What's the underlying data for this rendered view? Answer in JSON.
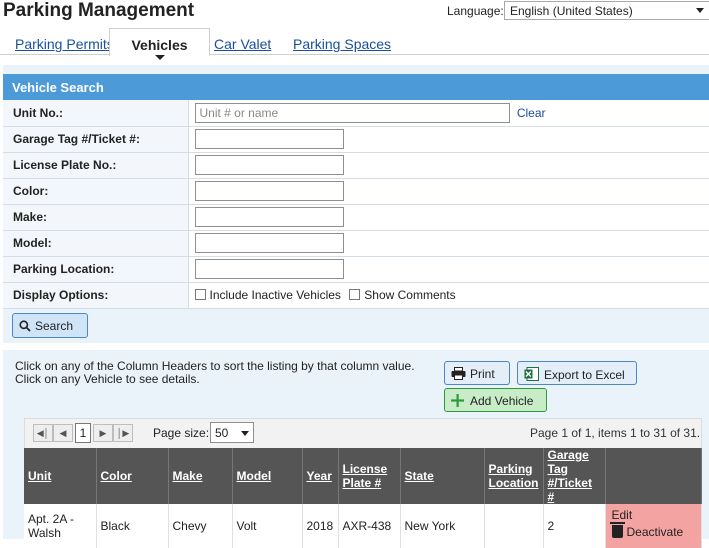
{
  "app": {
    "title": "Parking Management"
  },
  "language": {
    "label": "Language:",
    "selected": "English (United States)"
  },
  "tabs": [
    {
      "label": "Parking Permits",
      "active": false
    },
    {
      "label": "Vehicles",
      "active": true
    },
    {
      "label": "Car Valet",
      "active": false
    },
    {
      "label": "Parking Spaces",
      "active": false
    }
  ],
  "search_panel": {
    "title": "Vehicle Search",
    "fields": {
      "unit": {
        "label": "Unit No.:",
        "placeholder": "Unit # or name",
        "clear": "Clear"
      },
      "garage_tag": {
        "label": "Garage Tag #/Ticket #:"
      },
      "license_plate": {
        "label": "License Plate No.:"
      },
      "color": {
        "label": "Color:"
      },
      "make": {
        "label": "Make:"
      },
      "model": {
        "label": "Model:"
      },
      "parking_location": {
        "label": "Parking Location:"
      }
    },
    "display_options": {
      "label": "Display Options:",
      "include_inactive": "Include Inactive Vehicles",
      "show_comments": "Show Comments"
    },
    "search_button": "Search"
  },
  "results": {
    "hint": "Click on any of the Column Headers to sort the listing by that column value. Click on any Vehicle to see details.",
    "print_button": "Print",
    "export_button": "Export to Excel",
    "add_button": "Add Vehicle",
    "pager": {
      "current_page": "1",
      "page_size_label": "Page size:",
      "page_size": "50",
      "info": "Page 1 of 1, items 1 to 31 of 31."
    },
    "columns": [
      "Unit",
      "Color",
      "Make",
      "Model",
      "Year",
      "License Plate #",
      "State",
      "Parking Location",
      "Garage Tag #/Ticket #"
    ],
    "rows": [
      {
        "unit": "Apt. 2A - Walsh",
        "color": "Black",
        "make": "Chevy",
        "model": "Volt",
        "year": "2018",
        "license_plate": "AXR-438",
        "state": "New York",
        "parking_location": "",
        "garage_tag": "2",
        "edit": "Edit",
        "deactivate": "Deactivate"
      }
    ]
  },
  "colors": {
    "accent": "#4d9ad8",
    "header_dark": "#555555",
    "action_highlight": "#f4a3a3",
    "add_green": "#c9ecc8"
  }
}
